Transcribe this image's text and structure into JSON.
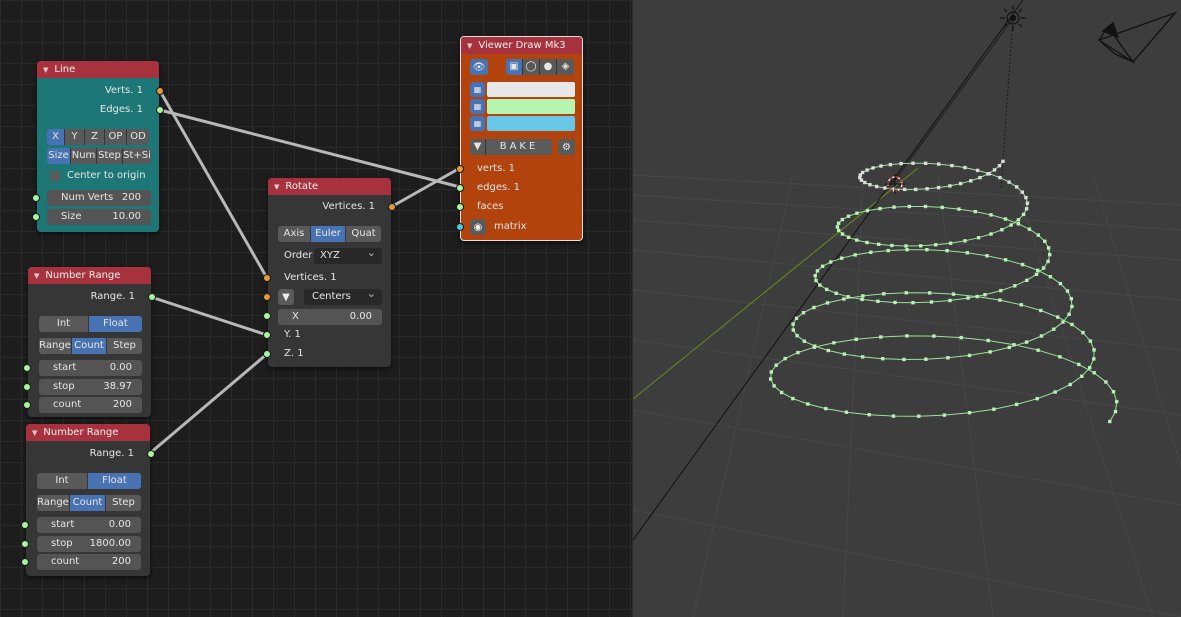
{
  "line_node": {
    "title": "Line",
    "verts_out": "Verts. 1",
    "edges_out": "Edges. 1",
    "axes": [
      "X",
      "Y",
      "Z",
      "OP",
      "OD"
    ],
    "modes": [
      "Size",
      "Num",
      "Step",
      "St+Si"
    ],
    "center_label": "Center to origin",
    "num_verts_label": "Num Verts",
    "num_verts_value": "200",
    "size_label": "Size",
    "size_value": "10.00"
  },
  "range_node_1": {
    "title": "Number Range",
    "out_label": "Range. 1",
    "types": [
      "Int",
      "Float"
    ],
    "modes": [
      "Range",
      "Count",
      "Step"
    ],
    "start_label": "start",
    "start_value": "0.00",
    "stop_label": "stop",
    "stop_value": "38.97",
    "count_label": "count",
    "count_value": "200"
  },
  "range_node_2": {
    "title": "Number Range",
    "out_label": "Range. 1",
    "types": [
      "Int",
      "Float"
    ],
    "modes": [
      "Range",
      "Count",
      "Step"
    ],
    "start_label": "start",
    "start_value": "0.00",
    "stop_label": "stop",
    "stop_value": "1800.00",
    "count_label": "count",
    "count_value": "200"
  },
  "rotate_node": {
    "title": "Rotate",
    "vertices_out": "Vertices. 1",
    "modes": [
      "Axis",
      "Euler",
      "Quat"
    ],
    "order_label": "Order",
    "order_value": "XYZ",
    "vertices_in": "Vertices. 1",
    "centers_value": "Centers",
    "x_label": "X",
    "x_value": "0.00",
    "y_in": "Y. 1",
    "z_in": "Z. 1"
  },
  "viewer_node": {
    "title": "Viewer Draw Mk3",
    "bake_label": "BAKE",
    "verts_in": "verts. 1",
    "edges_in": "edges. 1",
    "faces_in": "faces",
    "matrix_in": "matrix",
    "colors": [
      "#e8e8e8",
      "#b6f5b0",
      "#68c6e6"
    ]
  },
  "colors": {
    "header": "#a7323d",
    "line_body": "#1d7777",
    "viewer_body": "#b3430c",
    "socket_green": "#a7f5a0",
    "socket_orange": "#e79a38",
    "socket_cyan": "#49c9e3",
    "accent_blue": "#4772b3"
  }
}
